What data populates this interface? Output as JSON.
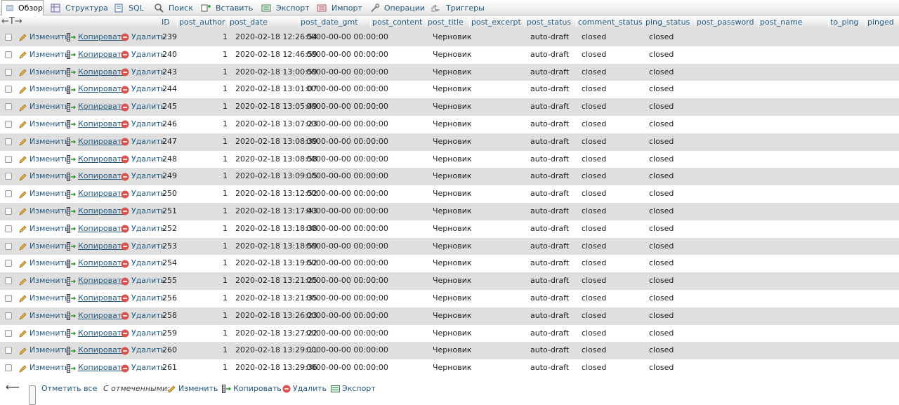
{
  "tabs": [
    {
      "label": "Обзор",
      "icon": "browse-icon",
      "active": true
    },
    {
      "label": "Структура",
      "icon": "structure-icon",
      "active": false
    },
    {
      "label": "SQL",
      "icon": "sql-icon",
      "active": false
    },
    {
      "label": "Поиск",
      "icon": "search-icon",
      "active": false
    },
    {
      "label": "Вставить",
      "icon": "insert-icon",
      "active": false
    },
    {
      "label": "Экспорт",
      "icon": "export-icon",
      "active": false
    },
    {
      "label": "Импорт",
      "icon": "import-icon",
      "active": false
    },
    {
      "label": "Операции",
      "icon": "operations-icon",
      "active": false
    },
    {
      "label": "Триггеры",
      "icon": "triggers-icon",
      "active": false
    }
  ],
  "header": {
    "arrows": "←T→",
    "columns": [
      "ID",
      "post_author",
      "post_date",
      "post_date_gmt",
      "post_content",
      "post_title",
      "post_excerpt",
      "post_status",
      "comment_status",
      "ping_status",
      "post_password",
      "post_name",
      "to_ping",
      "pinged"
    ]
  },
  "row_actions": {
    "edit": "Изменить",
    "copy": "Копировать",
    "delete": "Удалить"
  },
  "rows": [
    {
      "id": "239",
      "author": "1",
      "date": "2020-02-18 12:26:54",
      "date_gmt": "0000-00-00 00:00:00",
      "title": "Черновик",
      "status": "auto-draft",
      "comment_status": "closed",
      "ping_status": "closed"
    },
    {
      "id": "240",
      "author": "1",
      "date": "2020-02-18 12:46:59",
      "date_gmt": "0000-00-00 00:00:00",
      "title": "Черновик",
      "status": "auto-draft",
      "comment_status": "closed",
      "ping_status": "closed"
    },
    {
      "id": "243",
      "author": "1",
      "date": "2020-02-18 13:00:59",
      "date_gmt": "0000-00-00 00:00:00",
      "title": "Черновик",
      "status": "auto-draft",
      "comment_status": "closed",
      "ping_status": "closed"
    },
    {
      "id": "244",
      "author": "1",
      "date": "2020-02-18 13:01:07",
      "date_gmt": "0000-00-00 00:00:00",
      "title": "Черновик",
      "status": "auto-draft",
      "comment_status": "closed",
      "ping_status": "closed"
    },
    {
      "id": "245",
      "author": "1",
      "date": "2020-02-18 13:05:49",
      "date_gmt": "0000-00-00 00:00:00",
      "title": "Черновик",
      "status": "auto-draft",
      "comment_status": "closed",
      "ping_status": "closed"
    },
    {
      "id": "246",
      "author": "1",
      "date": "2020-02-18 13:07:23",
      "date_gmt": "0000-00-00 00:00:00",
      "title": "Черновик",
      "status": "auto-draft",
      "comment_status": "closed",
      "ping_status": "closed"
    },
    {
      "id": "247",
      "author": "1",
      "date": "2020-02-18 13:08:39",
      "date_gmt": "0000-00-00 00:00:00",
      "title": "Черновик",
      "status": "auto-draft",
      "comment_status": "closed",
      "ping_status": "closed"
    },
    {
      "id": "248",
      "author": "1",
      "date": "2020-02-18 13:08:58",
      "date_gmt": "0000-00-00 00:00:00",
      "title": "Черновик",
      "status": "auto-draft",
      "comment_status": "closed",
      "ping_status": "closed"
    },
    {
      "id": "249",
      "author": "1",
      "date": "2020-02-18 13:09:15",
      "date_gmt": "0000-00-00 00:00:00",
      "title": "Черновик",
      "status": "auto-draft",
      "comment_status": "closed",
      "ping_status": "closed"
    },
    {
      "id": "250",
      "author": "1",
      "date": "2020-02-18 13:12:52",
      "date_gmt": "0000-00-00 00:00:00",
      "title": "Черновик",
      "status": "auto-draft",
      "comment_status": "closed",
      "ping_status": "closed"
    },
    {
      "id": "251",
      "author": "1",
      "date": "2020-02-18 13:17:43",
      "date_gmt": "0000-00-00 00:00:00",
      "title": "Черновик",
      "status": "auto-draft",
      "comment_status": "closed",
      "ping_status": "closed"
    },
    {
      "id": "252",
      "author": "1",
      "date": "2020-02-18 13:18:38",
      "date_gmt": "0000-00-00 00:00:00",
      "title": "Черновик",
      "status": "auto-draft",
      "comment_status": "closed",
      "ping_status": "closed"
    },
    {
      "id": "253",
      "author": "1",
      "date": "2020-02-18 13:18:59",
      "date_gmt": "0000-00-00 00:00:00",
      "title": "Черновик",
      "status": "auto-draft",
      "comment_status": "closed",
      "ping_status": "closed"
    },
    {
      "id": "254",
      "author": "1",
      "date": "2020-02-18 13:19:52",
      "date_gmt": "0000-00-00 00:00:00",
      "title": "Черновик",
      "status": "auto-draft",
      "comment_status": "closed",
      "ping_status": "closed"
    },
    {
      "id": "255",
      "author": "1",
      "date": "2020-02-18 13:21:25",
      "date_gmt": "0000-00-00 00:00:00",
      "title": "Черновик",
      "status": "auto-draft",
      "comment_status": "closed",
      "ping_status": "closed"
    },
    {
      "id": "256",
      "author": "1",
      "date": "2020-02-18 13:21:35",
      "date_gmt": "0000-00-00 00:00:00",
      "title": "Черновик",
      "status": "auto-draft",
      "comment_status": "closed",
      "ping_status": "closed"
    },
    {
      "id": "258",
      "author": "1",
      "date": "2020-02-18 13:26:23",
      "date_gmt": "0000-00-00 00:00:00",
      "title": "Черновик",
      "status": "auto-draft",
      "comment_status": "closed",
      "ping_status": "closed"
    },
    {
      "id": "259",
      "author": "1",
      "date": "2020-02-18 13:27:22",
      "date_gmt": "0000-00-00 00:00:00",
      "title": "Черновик",
      "status": "auto-draft",
      "comment_status": "closed",
      "ping_status": "closed"
    },
    {
      "id": "260",
      "author": "1",
      "date": "2020-02-18 13:29:11",
      "date_gmt": "0000-00-00 00:00:00",
      "title": "Черновик",
      "status": "auto-draft",
      "comment_status": "closed",
      "ping_status": "closed"
    },
    {
      "id": "261",
      "author": "1",
      "date": "2020-02-18 13:29:36",
      "date_gmt": "0000-00-00 00:00:00",
      "title": "Черновик",
      "status": "auto-draft",
      "comment_status": "closed",
      "ping_status": "closed"
    }
  ],
  "footer": {
    "check_all": "Отметить все",
    "with_selected": "С отмеченными:",
    "edit": "Изменить",
    "copy": "Копировать",
    "delete": "Удалить",
    "export": "Экспорт"
  },
  "colors": {
    "link": "#235a81",
    "row_alt": "#dfdfdf",
    "delete_icon": "#d9534f",
    "edit_icon": "#e0a030"
  }
}
